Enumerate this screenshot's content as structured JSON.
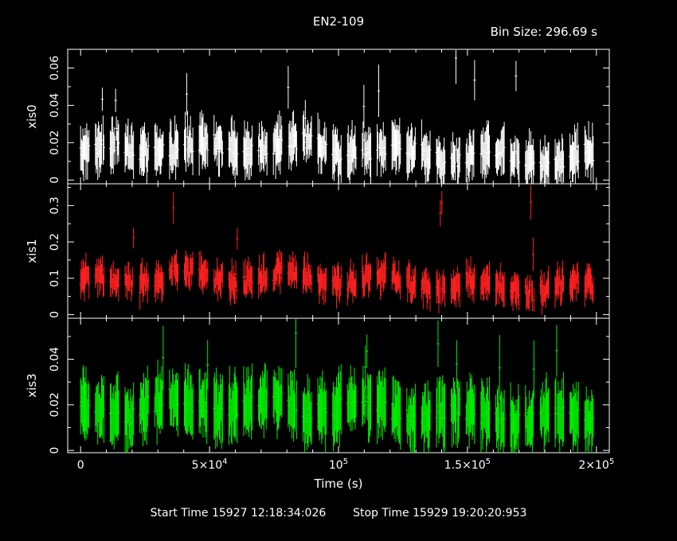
{
  "title": "EN2-109",
  "bin_size": "Bin Size: 296.69 s",
  "footer": {
    "start": "Start Time 15927 12:18:34:026",
    "stop": "Stop Time 15929 19:20:20:953"
  },
  "chart_data": {
    "type": "line",
    "title": "EN2-109",
    "xlabel": "Time (s)",
    "xlim": [
      -5000,
      205000
    ],
    "xticks": [
      0,
      50000,
      100000,
      150000,
      200000
    ],
    "xtick_labels": [
      "0",
      "5×10",
      "10",
      "1.5×10",
      "2×10"
    ],
    "xtick_exponents": [
      "",
      "4",
      "5",
      "5",
      "5"
    ],
    "panels": [
      {
        "name": "xis0",
        "ylabel": "xis0",
        "color": "#ffffff",
        "ylim": [
          -0.002,
          0.07
        ],
        "yticks": [
          0,
          0.02,
          0.04,
          0.06
        ],
        "ytick_labels": [
          "0",
          "0.02",
          "0.04",
          "0.06"
        ],
        "baseline": 0.015,
        "amp": 0.006,
        "err": 0.01,
        "spike_max": 0.066
      },
      {
        "name": "xis1",
        "ylabel": "xis1",
        "color": "#ff2020",
        "ylim": [
          -0.01,
          0.36
        ],
        "yticks": [
          0,
          0.1,
          0.2,
          0.3
        ],
        "ytick_labels": [
          "0",
          "0.1",
          "0.2",
          "0.3"
        ],
        "baseline": 0.09,
        "amp": 0.03,
        "err": 0.035,
        "spike_max": 0.34
      },
      {
        "name": "xis3",
        "ylabel": "xis3",
        "color": "#00ee00",
        "ylim": [
          -0.001,
          0.058
        ],
        "yticks": [
          0,
          0.02,
          0.04
        ],
        "ytick_labels": [
          "0",
          "0.02",
          "0.04"
        ],
        "baseline": 0.017,
        "amp": 0.006,
        "err": 0.011,
        "spike_max": 0.056
      }
    ]
  }
}
